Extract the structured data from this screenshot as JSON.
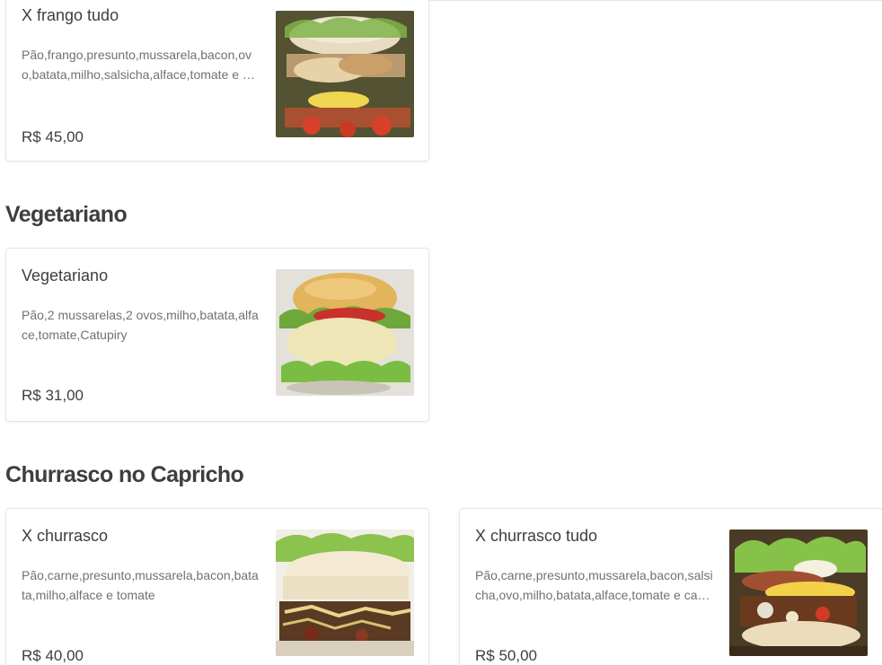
{
  "sections": [
    {
      "items": [
        {
          "name": "X frango tudo",
          "description": "Pão,frango,presunto,mussarela,bacon,ovo,batata,milho,salsicha,alface,tomate e catupiry",
          "price": "R$ 45,00",
          "image_icon": "burger-photo"
        }
      ]
    },
    {
      "title": "Vegetariano",
      "items": [
        {
          "name": "Vegetariano",
          "description": "Pão,2 mussarelas,2 ovos,milho,batata,alface,tomate,Catupiry",
          "price": "R$ 31,00",
          "image_icon": "burger-photo"
        }
      ]
    },
    {
      "title": "Churrasco no Capricho",
      "items": [
        {
          "name": "X churrasco",
          "description": "Pão,carne,presunto,mussarela,bacon,batata,milho,alface e tomate",
          "price": "R$ 40,00",
          "image_icon": "burger-photo"
        },
        {
          "name": "X churrasco tudo",
          "description": "Pão,carne,presunto,mussarela,bacon,salsicha,ovo,milho,batata,alface,tomate e catupiry",
          "price": "R$ 50,00",
          "image_icon": "burger-photo"
        }
      ]
    }
  ],
  "colors": {
    "text_primary": "#3e3e3e",
    "text_secondary": "#717171",
    "card_border": "#e6e6e6"
  }
}
